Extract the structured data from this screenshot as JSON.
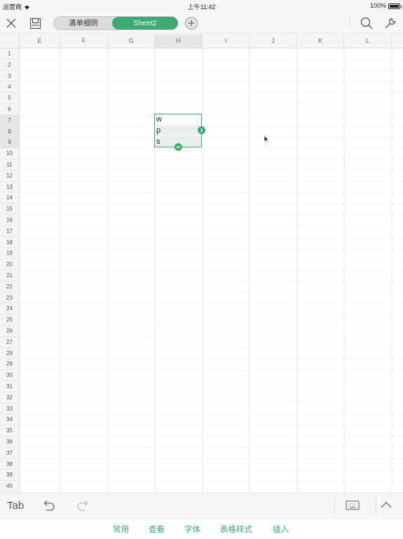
{
  "status": {
    "carrier": "运营商 ",
    "time": "上午11:42",
    "battery": "100%"
  },
  "toolbar": {
    "tabs": [
      {
        "label": "清单细则",
        "active": false
      },
      {
        "label": "Sheet2",
        "active": true
      }
    ],
    "accent_color": "#3daa73"
  },
  "columns": [
    "E",
    "F",
    "G",
    "H",
    "I",
    "J",
    "K",
    "L"
  ],
  "selected_column": "H",
  "rows": [
    "1",
    "2",
    "3",
    "4",
    "5",
    "6",
    "7",
    "8",
    "9",
    "10",
    "11",
    "12",
    "13",
    "14",
    "15",
    "16",
    "17",
    "18",
    "19",
    "20",
    "21",
    "22",
    "23",
    "24",
    "25",
    "26",
    "27",
    "28",
    "29",
    "30",
    "31",
    "32",
    "33",
    "34",
    "35",
    "36",
    "37",
    "38",
    "39",
    "40"
  ],
  "selected_rows": [
    "7",
    "8",
    "9"
  ],
  "cells": [
    {
      "ref": "H7",
      "value": "w"
    },
    {
      "ref": "H8",
      "value": "p"
    },
    {
      "ref": "H9",
      "value": "s"
    }
  ],
  "edit_bar": {
    "tab_label": "Tab"
  },
  "menu": [
    "常用",
    "查看",
    "字体",
    "表格样式",
    "插入"
  ]
}
